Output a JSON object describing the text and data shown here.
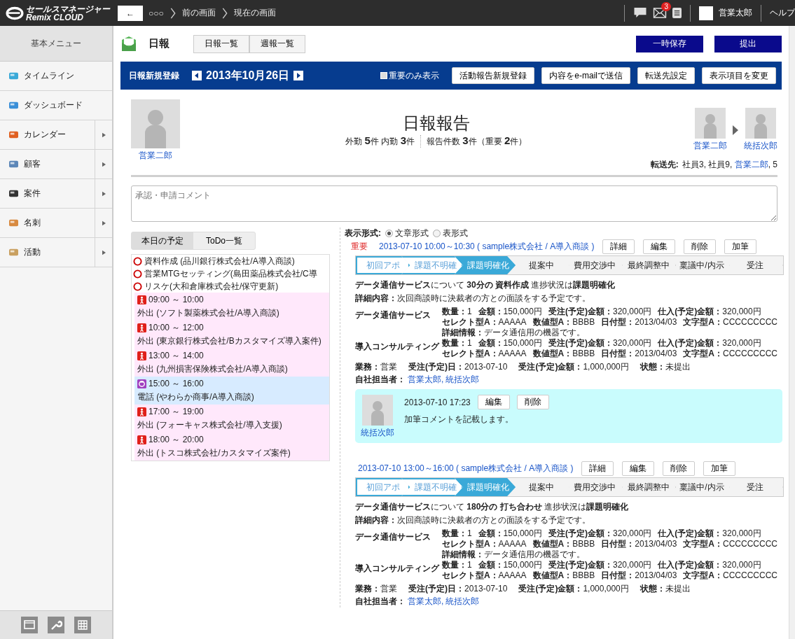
{
  "topbar": {
    "logo_line1": "セールスマネージャー",
    "logo_line2": "Remix CLOUD",
    "back": "←",
    "breadcrumbs": [
      "○○○",
      "前の画面",
      "現在の画面"
    ],
    "mail_badge": "3",
    "user": "営業太郎",
    "help": "ヘルプ"
  },
  "sidebar": {
    "title": "基本メニュー",
    "items": [
      {
        "label": "タイムライン",
        "submenu": false
      },
      {
        "label": "ダッシュボード",
        "submenu": false
      },
      {
        "label": "カレンダー",
        "submenu": true
      },
      {
        "label": "顧客",
        "submenu": true
      },
      {
        "label": "案件",
        "submenu": true
      },
      {
        "label": "名刺",
        "submenu": true
      },
      {
        "label": "活動",
        "submenu": true
      }
    ]
  },
  "header": {
    "title": "日報",
    "tabs": [
      {
        "label": "日報一覧",
        "selected": false
      },
      {
        "label": "週報一覧",
        "selected": false
      }
    ],
    "buttons": [
      "一時保存",
      "提出"
    ]
  },
  "toolbar": {
    "title": "日報新規登録",
    "date": "2013年10月26日",
    "important_only": {
      "label": "重要のみ表示",
      "checked": false
    },
    "buttons": [
      "活動報告新規登録",
      "内容をe-mailで送信",
      "転送先設定",
      "表示項目を変更"
    ]
  },
  "report": {
    "author": "営業二郎",
    "title": "日報報告",
    "stats": [
      "外勤 **5**件 内勤 **3**件",
      "報告件数 **3**件（重要 **2**件）"
    ],
    "approvers": [
      "営業二郎",
      "統括次郎"
    ],
    "forward_label": "転送先:",
    "forward": [
      {
        "text": "社員3, 社員9, ",
        "link": false
      },
      {
        "text": "営業二郎",
        "link": true
      },
      {
        "text": ", 5",
        "link": false
      }
    ],
    "comment_placeholder": "承認・申請コメント"
  },
  "schedule": {
    "tabs": [
      {
        "label": "本日の予定",
        "selected": true
      },
      {
        "label": "ToDo一覧",
        "selected": false
      }
    ],
    "items": [
      {
        "kind": "todo",
        "text": "資料作成 (品川銀行株式会社/A導入商談)"
      },
      {
        "kind": "todo",
        "text": "営業MTGセッティング(島田薬品株式会社/C導"
      },
      {
        "kind": "todo",
        "text": "リスケ(大和倉庫株式会社/保守更新)"
      },
      {
        "kind": "visit",
        "time": "09:00 ～ 10:00",
        "text": "外出 (ソフト製薬株式会社/A導入商談)"
      },
      {
        "kind": "visit",
        "time": "10:00 ～ 12:00",
        "text": "外出 (東京銀行株式会社/Bカスタマイズ導入案件)"
      },
      {
        "kind": "visit",
        "time": "13:00 ～ 14:00",
        "text": "外出 (九州損害保険株式会社/A導入商談)"
      },
      {
        "kind": "call",
        "time": "15:00 ～ 16:00",
        "text": "電話 (やわらか商事/A導入商談)"
      },
      {
        "kind": "visit",
        "time": "17:00 ～ 19:00",
        "text": "外出 (フォーキャス株式会社/導入支援)"
      },
      {
        "kind": "visit",
        "time": "18:00 ～ 20:00",
        "text": "外出 (トスコ株式会社/カスタマイズ案件)"
      }
    ]
  },
  "display": {
    "label": "表示形式:",
    "options": [
      {
        "label": "文章形式",
        "selected": true
      },
      {
        "label": "表形式",
        "selected": false
      }
    ]
  },
  "entries": [
    {
      "important": "重要",
      "link": "2013-07-10 10:00～10:30 ( sample株式会社 / A導入商談 )",
      "buttons": [
        "詳細",
        "編集",
        "削除",
        "加筆"
      ],
      "stages": [
        {
          "label": "初回アポ",
          "kind": "done"
        },
        {
          "label": "課題不明確",
          "kind": "done"
        },
        {
          "label": "課題明確化",
          "kind": "current"
        },
        {
          "label": "提案中",
          "kind": "pending"
        },
        {
          "label": "費用交渉中",
          "kind": "pending"
        },
        {
          "label": "最終調整中",
          "kind": "pending"
        },
        {
          "label": "稟議中/内示",
          "kind": "pending"
        },
        {
          "label": "受注",
          "kind": "pending"
        }
      ],
      "summary": "**データ通信サービス**について **30分の** **資料作成** 進捗状況は**課題明確化**",
      "detail": "**詳細内容：**次回商談時に決裁者の方との面談をする予定です。",
      "products": [
        {
          "name": "データ通信サービス",
          "lines": [
            [
              "**数量：**1",
              "**金額：**150,000円",
              "**受注(予定)金額：**320,000円",
              "**仕入(予定)金額：**320,000円"
            ],
            [
              "**セレクト型A：**AAAAA",
              "**数値型A：**BBBB",
              "**日付型：**2013/04/03",
              "**文字型A：**CCCCCCCCC"
            ],
            [
              "**詳細情報：**データ通信用の機器です。"
            ]
          ]
        },
        {
          "name": "導入コンサルティング",
          "lines": [
            [
              "**数量：**1",
              "**金額：**150,000円",
              "**受注(予定)金額：**320,000円",
              "**仕入(予定)金額：**320,000円"
            ],
            [
              "**セレクト型A：**AAAAA",
              "**数値型A：**BBBB",
              "**日付型：**2013/04/03",
              "**文字型A：**CCCCCCCCC"
            ]
          ]
        }
      ],
      "footer": [
        "**業務：**営業",
        "**受注(予定)日：**2013-07-10",
        "**受注(予定)金額：**1,000,000円",
        "**状態：**未提出"
      ],
      "owners_label": "自社担当者：",
      "owners": [
        "営業太郎,",
        "統括次郎"
      ],
      "addendum": {
        "author": "統括次郎",
        "time": "2013-07-10 17:23",
        "buttons": [
          "編集",
          "削除"
        ],
        "text": "加筆コメントを記載します。"
      }
    },
    {
      "link": "2013-07-10 13:00～16:00 ( sample株式会社 / A導入商談 )",
      "buttons": [
        "詳細",
        "編集",
        "削除",
        "加筆"
      ],
      "stages": [
        {
          "label": "初回アポ",
          "kind": "done"
        },
        {
          "label": "課題不明確",
          "kind": "done"
        },
        {
          "label": "課題明確化",
          "kind": "current"
        },
        {
          "label": "提案中",
          "kind": "pending"
        },
        {
          "label": "費用交渉中",
          "kind": "pending"
        },
        {
          "label": "最終調整中",
          "kind": "pending"
        },
        {
          "label": "稟議中/内示",
          "kind": "pending"
        },
        {
          "label": "受注",
          "kind": "pending"
        }
      ],
      "summary": "**データ通信サービス**について **180分の** **打ち合わせ** 進捗状況は**課題明確化**",
      "detail": "**詳細内容：**次回商談時に決裁者の方との面談をする予定です。",
      "products": [
        {
          "name": "データ通信サービス",
          "lines": [
            [
              "**数量：**1",
              "**金額：**150,000円",
              "**受注(予定)金額：**320,000円",
              "**仕入(予定)金額：**320,000円"
            ],
            [
              "**セレクト型A：**AAAAA",
              "**数値型A：**BBBB",
              "**日付型：**2013/04/03",
              "**文字型A：**CCCCCCCCC"
            ],
            [
              "**詳細情報：**データ通信用の機器です。"
            ]
          ]
        },
        {
          "name": "導入コンサルティング",
          "lines": [
            [
              "**数量：**1",
              "**金額：**150,000円",
              "**受注(予定)金額：**320,000円",
              "**仕入(予定)金額：**320,000円"
            ],
            [
              "**セレクト型A：**AAAAA",
              "**数値型A：**BBBB",
              "**日付型：**2013/04/03",
              "**文字型A：**CCCCCCCCC"
            ]
          ]
        }
      ],
      "footer": [
        "**業務：**営業",
        "**受注(予定)日：**2013-07-10",
        "**受注(予定)金額：**1,000,000円",
        "**状態：**未提出"
      ],
      "owners_label": "自社担当者：",
      "owners": [
        "営業太郎,",
        "統括次郎"
      ]
    }
  ]
}
